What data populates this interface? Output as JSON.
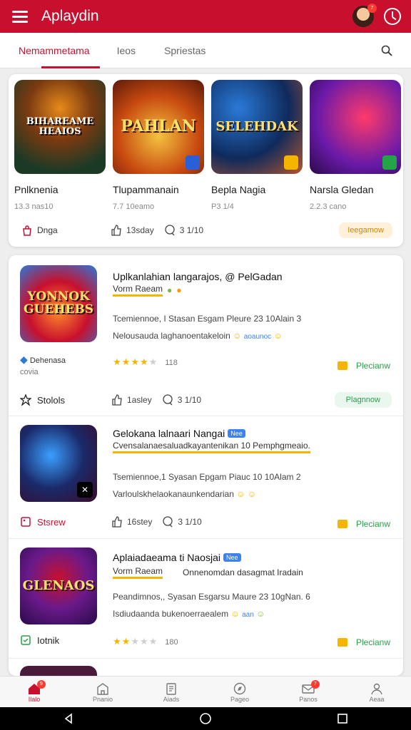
{
  "app": {
    "title": "Aplaydin",
    "avatar_badge": "7",
    "accent_color": "#c8102e"
  },
  "tabs": [
    {
      "label": "Nemammetama",
      "active": true
    },
    {
      "label": "Ieos",
      "active": false
    },
    {
      "label": "Spriestas",
      "active": false
    }
  ],
  "featured": {
    "items": [
      {
        "name": "Pnlknenia",
        "meta": "13.3 nas10",
        "thumb_text": "BIHAREAME HEAIOS",
        "colors": [
          "#1b3a26",
          "#e88a1a"
        ]
      },
      {
        "name": "Tlupammanain",
        "meta": "7.7 10eamo",
        "thumb_text": "PAHLAN",
        "colors": [
          "#c84a10",
          "#f4c240"
        ]
      },
      {
        "name": "Bepla Nagia",
        "meta": "P3 1/4",
        "thumb_text": "SELEHDAK",
        "colors": [
          "#0f2a5c",
          "#ff6a1a"
        ]
      },
      {
        "name": "Narsla Gledan",
        "meta": "2.2.3 cano",
        "thumb_text": "",
        "colors": [
          "#6a1aa8",
          "#ff3a6a"
        ]
      }
    ],
    "footer": {
      "left": "Dnga",
      "likes": "13sday",
      "comments": "3 1/10",
      "pill": "Ieegamow"
    }
  },
  "list": [
    {
      "title": "Uplkanlahian langarajos, @ PelGadan",
      "tag": "",
      "chip": "Vorm Raeam",
      "sub_extra": "",
      "line1": "Tcemiennoe, I Stasan Esgam Pleure 23 10Alain 3",
      "line2": "Nelousauda laghanoentakeloin",
      "line2_tail": "aoaunoc",
      "rating": 4,
      "rating_count": "118",
      "preview": "Plecianw",
      "developer_line1": "Dehenasa",
      "developer_line2": "covia",
      "footer_left": "Stolols",
      "likes": "1asley",
      "comments": "3 1/10",
      "footer_pill": "Plagnnow",
      "thumb_text": "YONNOK GUEHEBS"
    },
    {
      "title": "Gelokana lalnaari Nangai",
      "tag": "Nee",
      "chip": "Cvensalanaesaluadkayantenikan 10 Pemphgmeaio.",
      "sub_extra": "",
      "line1": "Tsemiennoe,1 Syasan Epgam Piauc 10 10Alam 2",
      "line2": "Varloulskhelaokanaunkendarian",
      "line2_tail": "",
      "rating": 0,
      "rating_count": "",
      "preview": "Plecianw",
      "footer_left": "Stsrew",
      "likes": "16stey",
      "comments": "3 1/10",
      "footer_pill": "",
      "thumb_text": ""
    },
    {
      "title": "Aplaiadaeama ti Naosjai",
      "tag": "Nee",
      "chip": "Vorm Raeam",
      "sub_extra": "Onnenomdan dasagmat Iradain",
      "line1": "Peandimnos,, Syasan Esgarsu Maure 23 10gNan. 6",
      "line2": "Isdiudaanda bukenoerraealem",
      "line2_tail": "aan",
      "rating": 2,
      "rating_count": "180",
      "preview": "Plecianw",
      "footer_left": "Iotnik",
      "likes": "",
      "comments": "",
      "footer_pill": "",
      "thumb_text": "GLENAOS"
    }
  ],
  "bottom_nav": [
    {
      "label": "Ilalo",
      "active": true,
      "badge": "9",
      "icon": "home-icon"
    },
    {
      "label": "Pnanio",
      "active": false,
      "badge": "",
      "icon": "building-icon"
    },
    {
      "label": "Aiads",
      "active": false,
      "badge": "",
      "icon": "document-icon"
    },
    {
      "label": "Pageo",
      "active": false,
      "badge": "",
      "icon": "compass-icon"
    },
    {
      "label": "Panos",
      "active": false,
      "badge": "7",
      "icon": "mail-icon"
    },
    {
      "label": "Aeaa",
      "active": false,
      "badge": "",
      "icon": "profile-icon"
    }
  ]
}
